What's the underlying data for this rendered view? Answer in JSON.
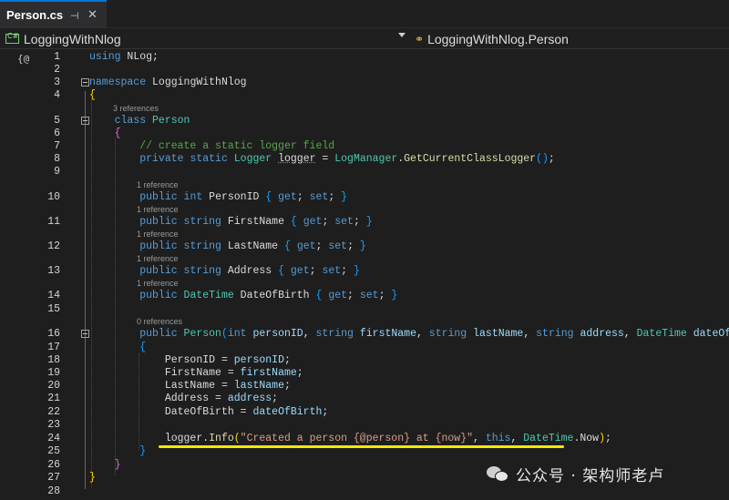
{
  "tab": {
    "title": "Person.cs",
    "pin_glyph": "⊣",
    "close_glyph": "✕"
  },
  "nav": {
    "project": "LoggingWithNlog",
    "member": "LoggingWithNlog.Person"
  },
  "gutter": {
    "glyph": "{@"
  },
  "code_lenses": {
    "refs3": "3 references",
    "ref1": "1 reference",
    "refs0": "0 references"
  },
  "code": {
    "using_kw": "using",
    "using_ns": "NLog",
    "ns_kw": "namespace",
    "ns_name": "LoggingWithNlog",
    "class_kw": "class",
    "class_name": "Person",
    "comment": "// create a static logger field",
    "private_kw": "private",
    "static_kw": "static",
    "logger_type": "Logger",
    "logger_name": "logger",
    "logmanager": "LogManager",
    "getlogger": "GetCurrentClassLogger",
    "public_kw": "public",
    "int_kw": "int",
    "string_kw": "string",
    "datetime_type": "DateTime",
    "get_kw": "get",
    "set_kw": "set",
    "p_personid": "PersonID",
    "p_firstname": "FirstName",
    "p_lastname": "LastName",
    "p_address": "Address",
    "p_dob": "DateOfBirth",
    "a_personid": "personID",
    "a_firstname": "firstName",
    "a_lastname": "lastName",
    "a_address": "address",
    "a_dob": "dateOfBirth",
    "info_fn": "Info",
    "log_string": "\"Created a person {@person} at {now}\"",
    "this_kw": "this",
    "now_prop": "Now"
  },
  "line_numbers": [
    "1",
    "2",
    "3",
    "4",
    "5",
    "6",
    "7",
    "8",
    "9",
    "10",
    "11",
    "12",
    "13",
    "14",
    "15",
    "16",
    "17",
    "18",
    "19",
    "20",
    "21",
    "22",
    "23",
    "24",
    "25",
    "26",
    "27",
    "28"
  ],
  "watermark": {
    "text": "公众号 · 架构师老卢"
  },
  "colors": {
    "keyword": "#569cd6",
    "type": "#4ec9b0",
    "comment": "#57a64a",
    "string": "#d69d85",
    "method": "#dcdcaa",
    "highlight": "#ffe600"
  }
}
